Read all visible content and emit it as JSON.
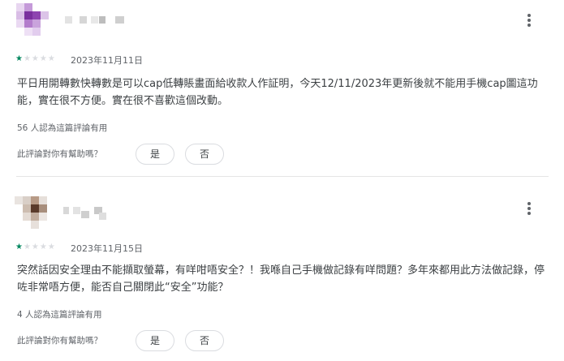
{
  "reviews": [
    {
      "rating": 1,
      "max_rating": 5,
      "date": "2023年11月11日",
      "text": "平日用開轉數快轉數是可以cap低轉賬畫面給收款人作証明，今天12/11/2023年更新後就不能用手機cap圖這功能，實在很不方便。實在很不喜歡這個改動。",
      "helpful_count_text": "56 人認為這篇評論有用",
      "helpful_question": "此評論對你有幫助嗎？",
      "yes_label": "是",
      "no_label": "否"
    },
    {
      "rating": 1,
      "max_rating": 5,
      "date": "2023年11月15日",
      "text": "突然話因安全理由不能擷取螢幕，有咩咁唔安全？！我喺自己手機做記錄有咩問題？多年來都用此方法做記錄，停咗非常唔方便，能否自己關閉此“安全”功能？",
      "helpful_count_text": "4 人認為這篇評論有用",
      "helpful_question": "此評論對你有幫助嗎？",
      "yes_label": "是",
      "no_label": "否"
    }
  ],
  "colors": {
    "star_filled": "#01875f",
    "star_empty": "#dadce0",
    "secondary_text": "#5f6368"
  },
  "icons": {
    "more": "more-vert-icon",
    "star": "star-icon"
  }
}
